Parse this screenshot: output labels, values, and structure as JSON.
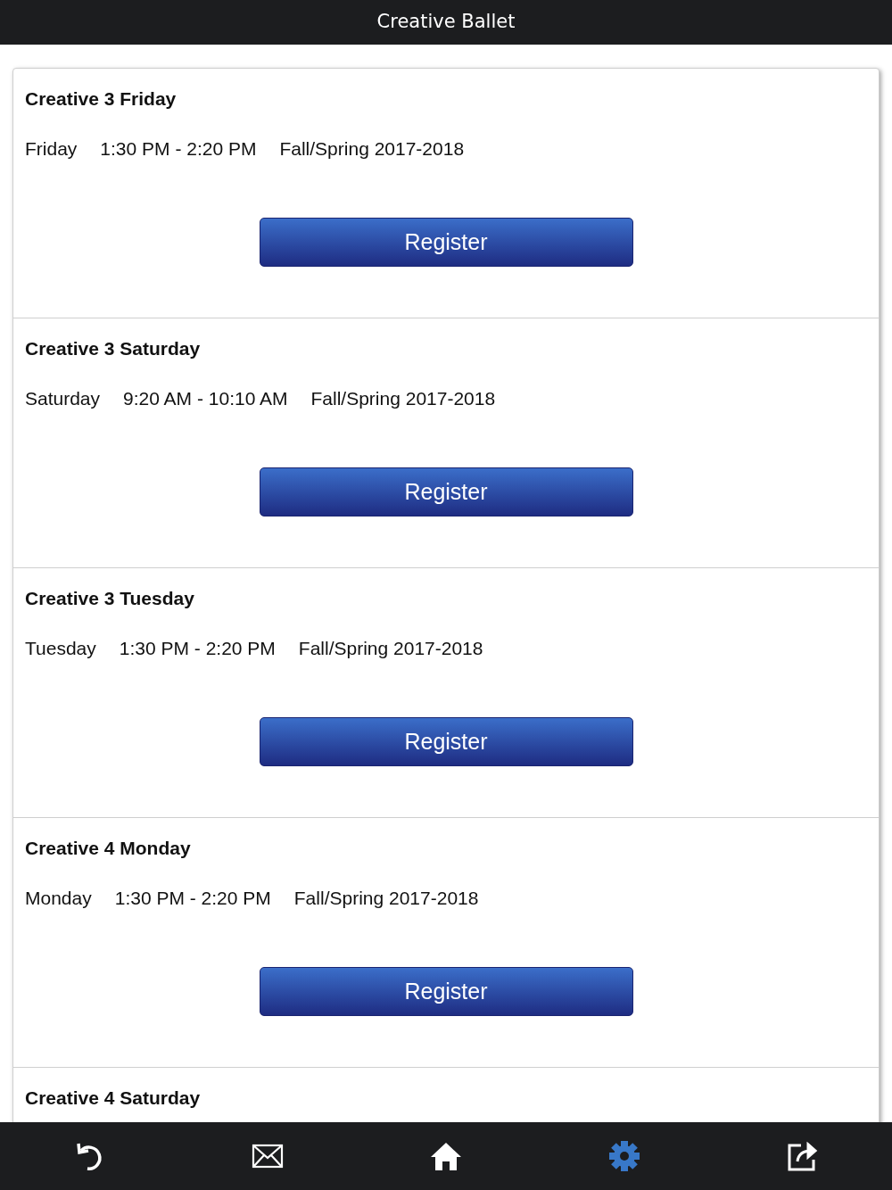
{
  "header": {
    "title": "Creative Ballet"
  },
  "classes": [
    {
      "title": "Creative 3 Friday",
      "day": "Friday",
      "time": "1:30 PM - 2:20 PM",
      "term": "Fall/Spring 2017-2018",
      "button": "Register"
    },
    {
      "title": "Creative 3 Saturday",
      "day": "Saturday",
      "time": "9:20 AM - 10:10 AM",
      "term": "Fall/Spring 2017-2018",
      "button": "Register"
    },
    {
      "title": "Creative 3 Tuesday",
      "day": "Tuesday",
      "time": "1:30 PM - 2:20 PM",
      "term": "Fall/Spring 2017-2018",
      "button": "Register"
    },
    {
      "title": "Creative 4 Monday",
      "day": "Monday",
      "time": "1:30 PM - 2:20 PM",
      "term": "Fall/Spring 2017-2018",
      "button": "Register"
    },
    {
      "title": "Creative 4 Saturday"
    }
  ],
  "tab_bar": [
    {
      "kind": "back",
      "selected": false
    },
    {
      "kind": "mail",
      "selected": false
    },
    {
      "kind": "home",
      "selected": false
    },
    {
      "kind": "settings",
      "selected": true
    },
    {
      "kind": "share",
      "selected": false
    }
  ]
}
